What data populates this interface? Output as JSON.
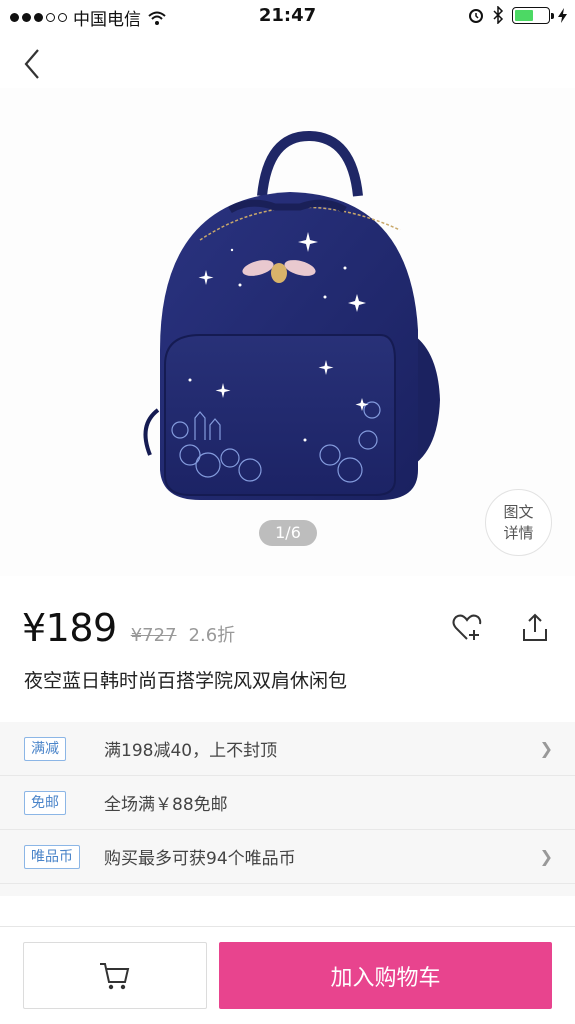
{
  "status_bar": {
    "carrier": "中国电信",
    "time": "21:47"
  },
  "gallery": {
    "indicator": "1/6",
    "detail_label_line1": "图文",
    "detail_label_line2": "详情"
  },
  "product": {
    "price": "¥189",
    "original_price": "¥727",
    "discount": "2.6折",
    "title": "夜空蓝日韩时尚百搭学院风双肩休闲包"
  },
  "promotions": [
    {
      "tag": "满减",
      "text": "满198减40，上不封顶",
      "has_chevron": true
    },
    {
      "tag": "免邮",
      "text": "全场满￥88免邮",
      "has_chevron": false
    },
    {
      "tag": "唯品币",
      "text": "购买最多可获94个唯品币",
      "has_chevron": true
    }
  ],
  "bottom_bar": {
    "add_to_cart_label": "加入购物车"
  },
  "icons": [
    "back-icon",
    "wifi-icon",
    "alarm-icon",
    "bluetooth-icon",
    "battery-icon",
    "charging-icon",
    "heart-plus-icon",
    "share-icon",
    "cart-icon",
    "chevron-right-icon"
  ],
  "colors": {
    "accent": "#e8448e",
    "tag_blue": "#4a84c9",
    "bag_navy": "#1f2766",
    "battery_green": "#4cd964"
  }
}
